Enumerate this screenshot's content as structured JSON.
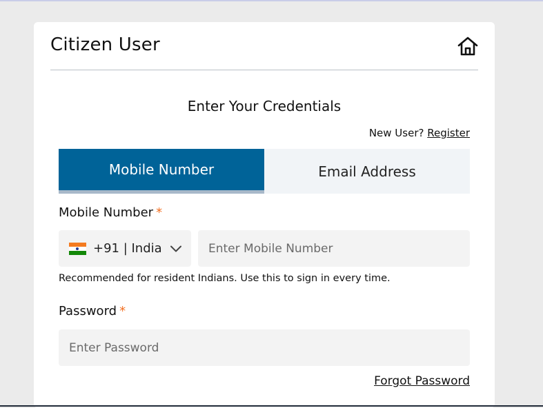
{
  "card": {
    "title": "Citizen User",
    "subtitle": "Enter Your Credentials"
  },
  "register": {
    "prompt": "New User?",
    "link_label": "Register"
  },
  "tabs": [
    {
      "label": "Mobile Number",
      "active": true
    },
    {
      "label": "Email Address",
      "active": false
    }
  ],
  "mobile": {
    "label": "Mobile Number",
    "required_mark": "*",
    "country_code": "+91 | India",
    "placeholder": "Enter Mobile Number",
    "value": "",
    "hint": "Recommended for resident Indians. Use this to sign in every time."
  },
  "password": {
    "label": "Password",
    "required_mark": "*",
    "placeholder": "Enter Password",
    "value": ""
  },
  "forgot_password_label": "Forgot Password",
  "icons": {
    "home": "home-icon",
    "flag": "india-flag-icon",
    "chevron": "chevron-down-icon"
  },
  "colors": {
    "accent": "#006398",
    "required": "#f26f21",
    "inactive_tab": "#f1f4f7",
    "input_bg": "#f3f3f3"
  }
}
